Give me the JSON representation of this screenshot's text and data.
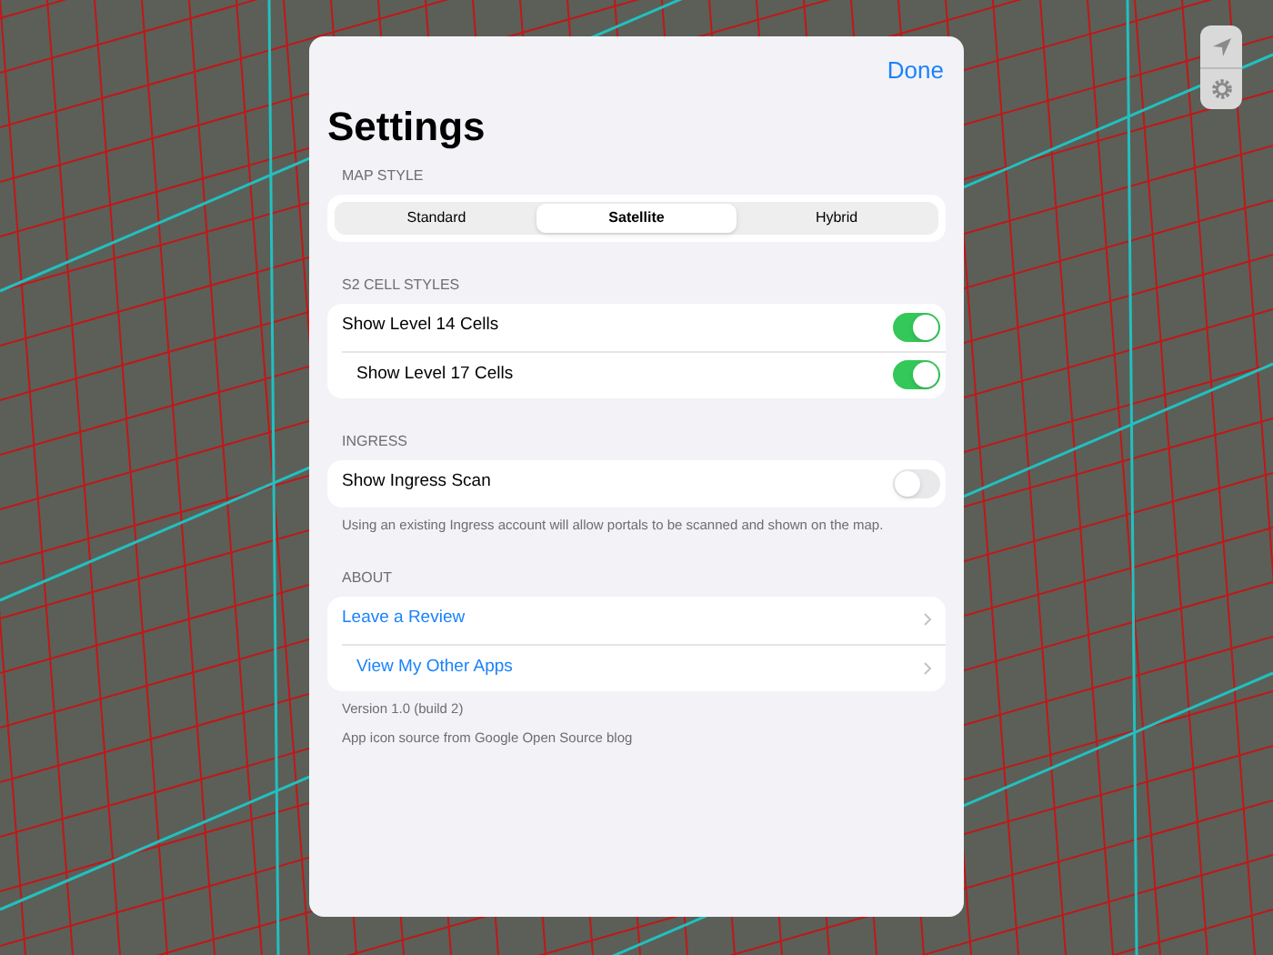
{
  "done": "Done",
  "title": "Settings",
  "sections": [
    {
      "header": "MAP STYLE",
      "kind": "segmented",
      "segments": [
        {
          "label": "Standard",
          "selected": false
        },
        {
          "label": "Satellite",
          "selected": true
        },
        {
          "label": "Hybrid",
          "selected": false
        }
      ]
    },
    {
      "header": "S2 CELL STYLES",
      "kind": "toggles",
      "rows": [
        {
          "label": "Show Level 14 Cells",
          "on": true
        },
        {
          "label": "Show Level 17 Cells",
          "on": true
        }
      ]
    },
    {
      "header": "INGRESS",
      "kind": "toggles",
      "rows": [
        {
          "label": "Show Ingress Scan",
          "on": false
        }
      ],
      "footers": [
        "Using an existing Ingress account will allow portals to be scanned and shown on the map."
      ]
    },
    {
      "header": "ABOUT",
      "kind": "links",
      "rows": [
        {
          "label": "Leave a Review"
        },
        {
          "label": "View My Other Apps"
        }
      ],
      "footers": [
        "Version 1.0 (build 2)",
        "App icon source from Google Open Source blog"
      ]
    }
  ]
}
